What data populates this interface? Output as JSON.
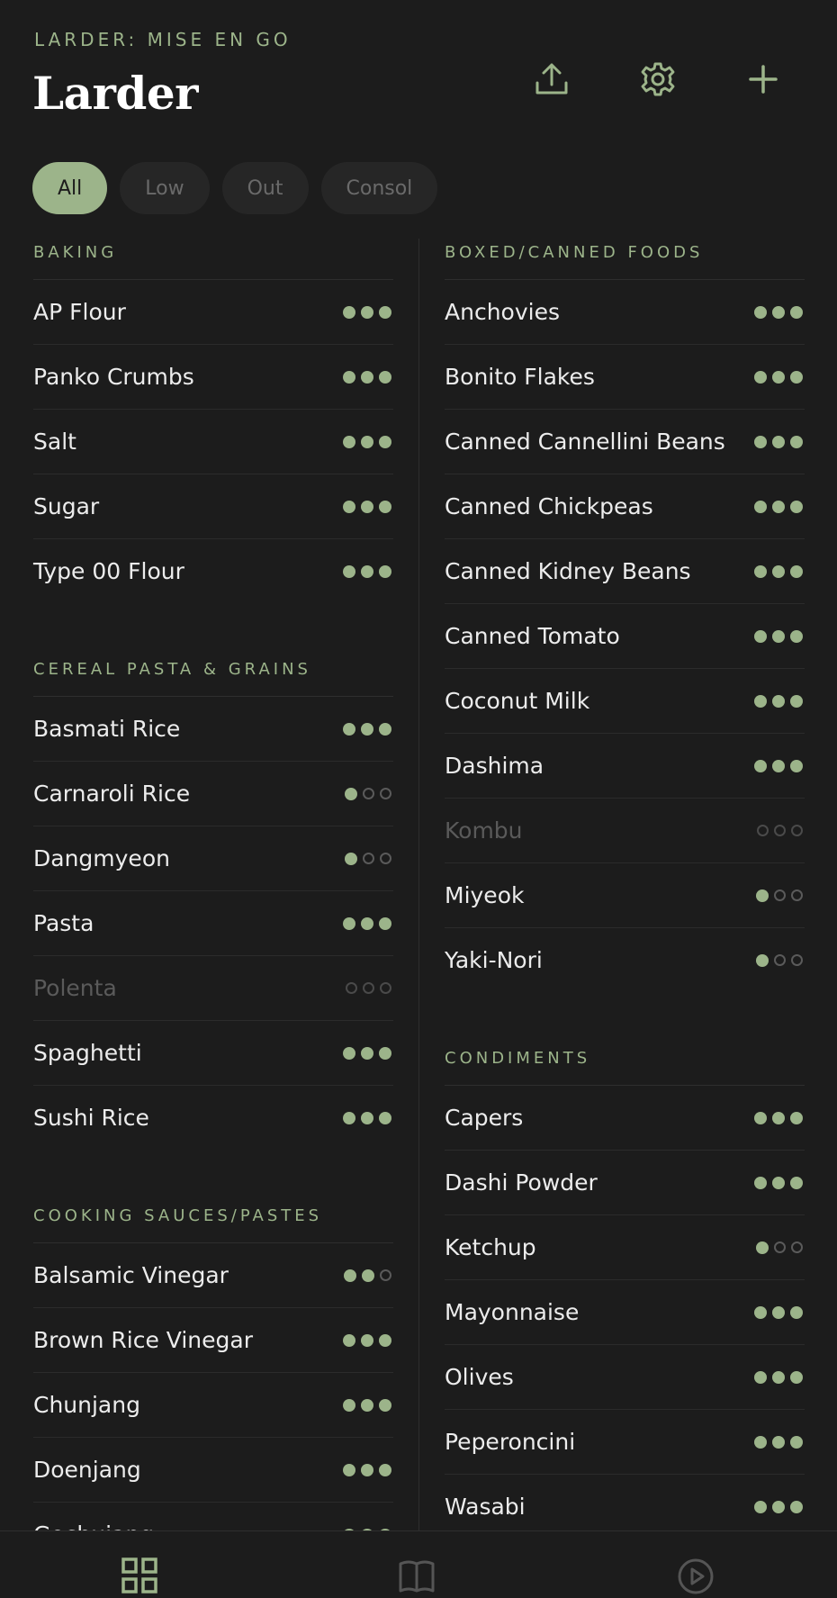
{
  "header": {
    "eyebrow": "LARDER: MISE EN GO",
    "title": "Larder"
  },
  "icons": {
    "accent": "#9cb48a",
    "header_buttons": [
      "share-icon",
      "gear-icon",
      "plus-icon"
    ],
    "nav": [
      "grid-icon",
      "book-icon",
      "play-icon"
    ]
  },
  "filters": [
    {
      "label": "All",
      "active": true
    },
    {
      "label": "Low",
      "active": false
    },
    {
      "label": "Out",
      "active": false
    },
    {
      "label": "Consol",
      "active": false
    }
  ],
  "columns": [
    {
      "sections": [
        {
          "title": "BAKING",
          "items": [
            {
              "name": "AP Flour",
              "level": 3
            },
            {
              "name": "Panko Crumbs",
              "level": 3
            },
            {
              "name": "Salt",
              "level": 3
            },
            {
              "name": "Sugar",
              "level": 3
            },
            {
              "name": "Type 00 Flour",
              "level": 3
            }
          ]
        },
        {
          "title": "CEREAL PASTA & GRAINS",
          "items": [
            {
              "name": "Basmati Rice",
              "level": 3
            },
            {
              "name": "Carnaroli Rice",
              "level": 1
            },
            {
              "name": "Dangmyeon",
              "level": 1
            },
            {
              "name": "Pasta",
              "level": 3
            },
            {
              "name": "Polenta",
              "level": 0
            },
            {
              "name": "Spaghetti",
              "level": 3
            },
            {
              "name": "Sushi Rice",
              "level": 3
            }
          ]
        },
        {
          "title": "COOKING SAUCES/PASTES",
          "items": [
            {
              "name": "Balsamic Vinegar",
              "level": 2
            },
            {
              "name": "Brown Rice Vinegar",
              "level": 3
            },
            {
              "name": "Chunjang",
              "level": 3
            },
            {
              "name": "Doenjang",
              "level": 3
            },
            {
              "name": "Gochujang",
              "level": 3
            }
          ]
        }
      ]
    },
    {
      "sections": [
        {
          "title": "BOXED/CANNED FOODS",
          "items": [
            {
              "name": "Anchovies",
              "level": 3
            },
            {
              "name": "Bonito Flakes",
              "level": 3
            },
            {
              "name": "Canned Cannellini Beans",
              "level": 3
            },
            {
              "name": "Canned Chickpeas",
              "level": 3
            },
            {
              "name": "Canned Kidney Beans",
              "level": 3
            },
            {
              "name": "Canned Tomato",
              "level": 3
            },
            {
              "name": "Coconut Milk",
              "level": 3
            },
            {
              "name": "Dashima",
              "level": 3
            },
            {
              "name": "Kombu",
              "level": 0
            },
            {
              "name": "Miyeok",
              "level": 1
            },
            {
              "name": "Yaki-Nori",
              "level": 1
            }
          ]
        },
        {
          "title": "CONDIMENTS",
          "items": [
            {
              "name": "Capers",
              "level": 3
            },
            {
              "name": "Dashi Powder",
              "level": 3
            },
            {
              "name": "Ketchup",
              "level": 1
            },
            {
              "name": "Mayonnaise",
              "level": 3
            },
            {
              "name": "Olives",
              "level": 3
            },
            {
              "name": "Peperoncini",
              "level": 3
            },
            {
              "name": "Wasabi",
              "level": 3
            }
          ]
        }
      ]
    }
  ]
}
